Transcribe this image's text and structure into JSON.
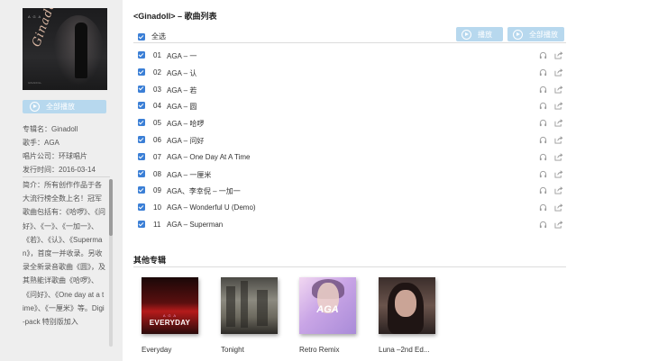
{
  "sidebar": {
    "cover_title": "Ginadoll",
    "cover_mini": "A G A",
    "cover_foot": "GINADOLL",
    "play_all_label": "全部播放",
    "info": {
      "album": "专辑名：Ginadoll",
      "singer": "歌手：AGA",
      "label": "唱片公司：环球唱片",
      "release": "发行时间：2016-03-14"
    },
    "description": "简介：所有创作作品于各大流行榜全数上名！冠军歌曲包括有：《哈啰》、《问好》、《一》、《一加一》、《若》、《认》、《Superman》，首度一并收录。另收录全新录音歌曲《圆》，及其熟能详歌曲《哈啰》、《问好》、《One day at a time》、《一厘米》等。Digi-pack 特别版加入"
  },
  "main": {
    "title": "<Ginadoll> – 歌曲列表",
    "select_all_label": "全选",
    "play_label": "播放",
    "play_all_label": "全部播放",
    "tracks": [
      {
        "num": "01",
        "title": "AGA – 一"
      },
      {
        "num": "02",
        "title": "AGA – 认"
      },
      {
        "num": "03",
        "title": "AGA – 若"
      },
      {
        "num": "04",
        "title": "AGA – 圆"
      },
      {
        "num": "05",
        "title": "AGA – 哈啰"
      },
      {
        "num": "06",
        "title": "AGA – 问好"
      },
      {
        "num": "07",
        "title": "AGA – One Day At A Time"
      },
      {
        "num": "08",
        "title": "AGA – 一厘米"
      },
      {
        "num": "09",
        "title": "AGA、李幸倪 – 一加一"
      },
      {
        "num": "10",
        "title": "AGA – Wonderful U (Demo)"
      },
      {
        "num": "11",
        "title": "AGA – Superman"
      }
    ]
  },
  "other_albums": {
    "title": "其他专辑",
    "albums": [
      {
        "name": "Everyday",
        "art_text": "EVERYDAY",
        "art_sub": "A G A"
      },
      {
        "name": "Tonight"
      },
      {
        "name": "Retro Remix",
        "art_text": "AGA"
      },
      {
        "name": "Luna –2nd Ed..."
      }
    ]
  },
  "colors": {
    "accent": "#3b7fd6",
    "button": "#b7d8ee",
    "sidebar_bg": "#eeeeee"
  }
}
